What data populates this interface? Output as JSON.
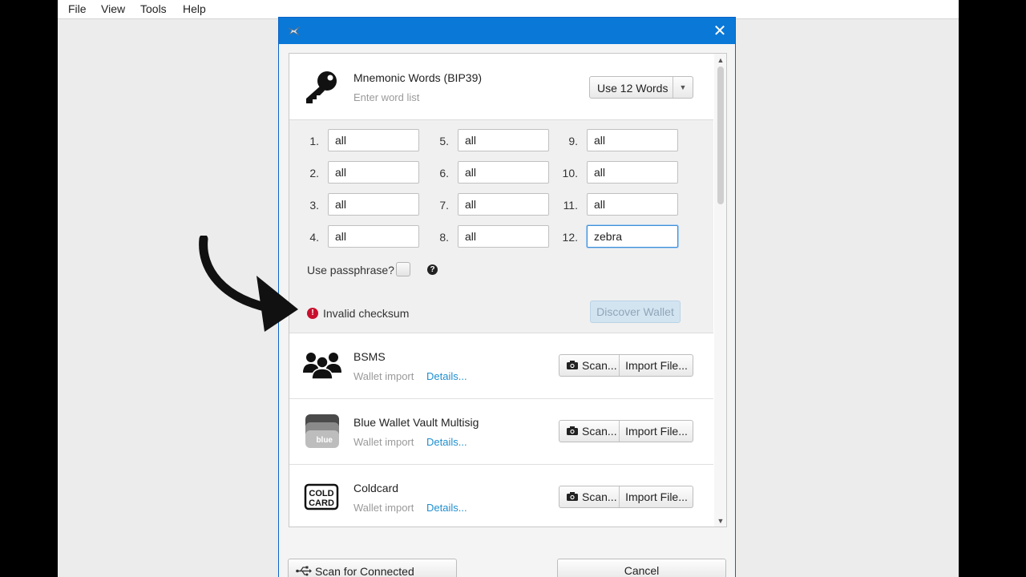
{
  "menubar": {
    "items": [
      {
        "label": "File"
      },
      {
        "label": "View"
      },
      {
        "label": "Tools"
      },
      {
        "label": "Help"
      }
    ]
  },
  "dialog": {
    "close_glyph": "✕",
    "mnemonic": {
      "title": "Mnemonic Words (BIP39)",
      "subtitle": "Enter word list",
      "word_count_selected": "Use 12 Words",
      "words": [
        {
          "num": "1.",
          "value": "all"
        },
        {
          "num": "2.",
          "value": "all"
        },
        {
          "num": "3.",
          "value": "all"
        },
        {
          "num": "4.",
          "value": "all"
        },
        {
          "num": "5.",
          "value": "all"
        },
        {
          "num": "6.",
          "value": "all"
        },
        {
          "num": "7.",
          "value": "all"
        },
        {
          "num": "8.",
          "value": "all"
        },
        {
          "num": "9.",
          "value": "all"
        },
        {
          "num": "10.",
          "value": "all"
        },
        {
          "num": "11.",
          "value": "all"
        },
        {
          "num": "12.",
          "value": "zebra"
        }
      ],
      "passphrase_label": "Use passphrase?",
      "passphrase_checked": false,
      "help_glyph": "?",
      "error_glyph": "!",
      "error_text": "Invalid checksum",
      "discover_label": "Discover Wallet"
    },
    "imports": [
      {
        "title": "BSMS",
        "subtitle": "Wallet import",
        "details": "Details...",
        "icon": "group-icon"
      },
      {
        "title": "Blue Wallet Vault Multisig",
        "subtitle": "Wallet import",
        "details": "Details...",
        "icon": "bluewallet-icon",
        "icon_text": "blue"
      },
      {
        "title": "Coldcard",
        "subtitle": "Wallet import",
        "details": "Details...",
        "icon": "coldcard-icon",
        "icon_text_1": "COLD",
        "icon_text_2": "CARD"
      }
    ],
    "scan_label": "Scan...",
    "import_file_label": "Import File...",
    "footer": {
      "scan_devices_label": "Scan for Connected Devices",
      "cancel_label": "Cancel"
    }
  },
  "colors": {
    "titlebar": "#0a78d7",
    "error": "#c8102e",
    "link": "#1e8fd0"
  }
}
